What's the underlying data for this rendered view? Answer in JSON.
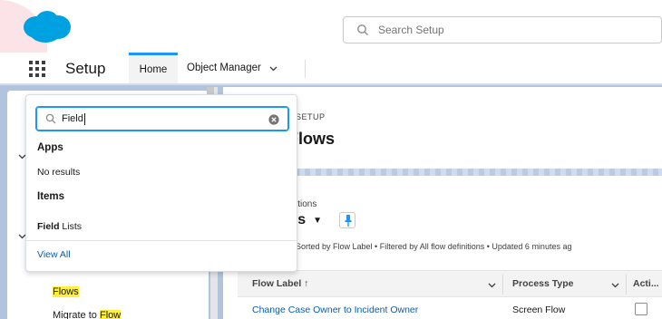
{
  "header": {
    "search_placeholder": "Search Setup"
  },
  "navbar": {
    "app_name": "Setup",
    "tabs": [
      {
        "label": "Home"
      },
      {
        "label": "Object Manager"
      }
    ]
  },
  "quick_find": {
    "value": "Field",
    "groups": [
      {
        "heading": "Apps",
        "result": "No results"
      },
      {
        "heading": "Items",
        "result_match": "Field",
        "result_rest": " Lists"
      }
    ],
    "view_all": "View All"
  },
  "tree": {
    "flows_label": "Flows",
    "migrate_prefix": "Migrate to ",
    "migrate_match": "Flow"
  },
  "page": {
    "breadcrumb": "SETUP",
    "title": "Flows",
    "list_subtitle": "itions",
    "list_view": "rs",
    "status": "Sorted by Flow Label • Filtered by All flow definitions • Updated 6 minutes ag"
  },
  "table": {
    "columns": [
      "Flow Label ↑",
      "Process Type",
      "Acti..."
    ],
    "rows": [
      {
        "label": "Change Case Owner to Incident Owner",
        "type": "Screen Flow",
        "active": false
      }
    ]
  },
  "colors": {
    "brand_blue": "#00a1e0",
    "link_blue": "#0b5cab",
    "accent_blue": "#1b96ff",
    "highlight_yellow": "#fff03f"
  }
}
